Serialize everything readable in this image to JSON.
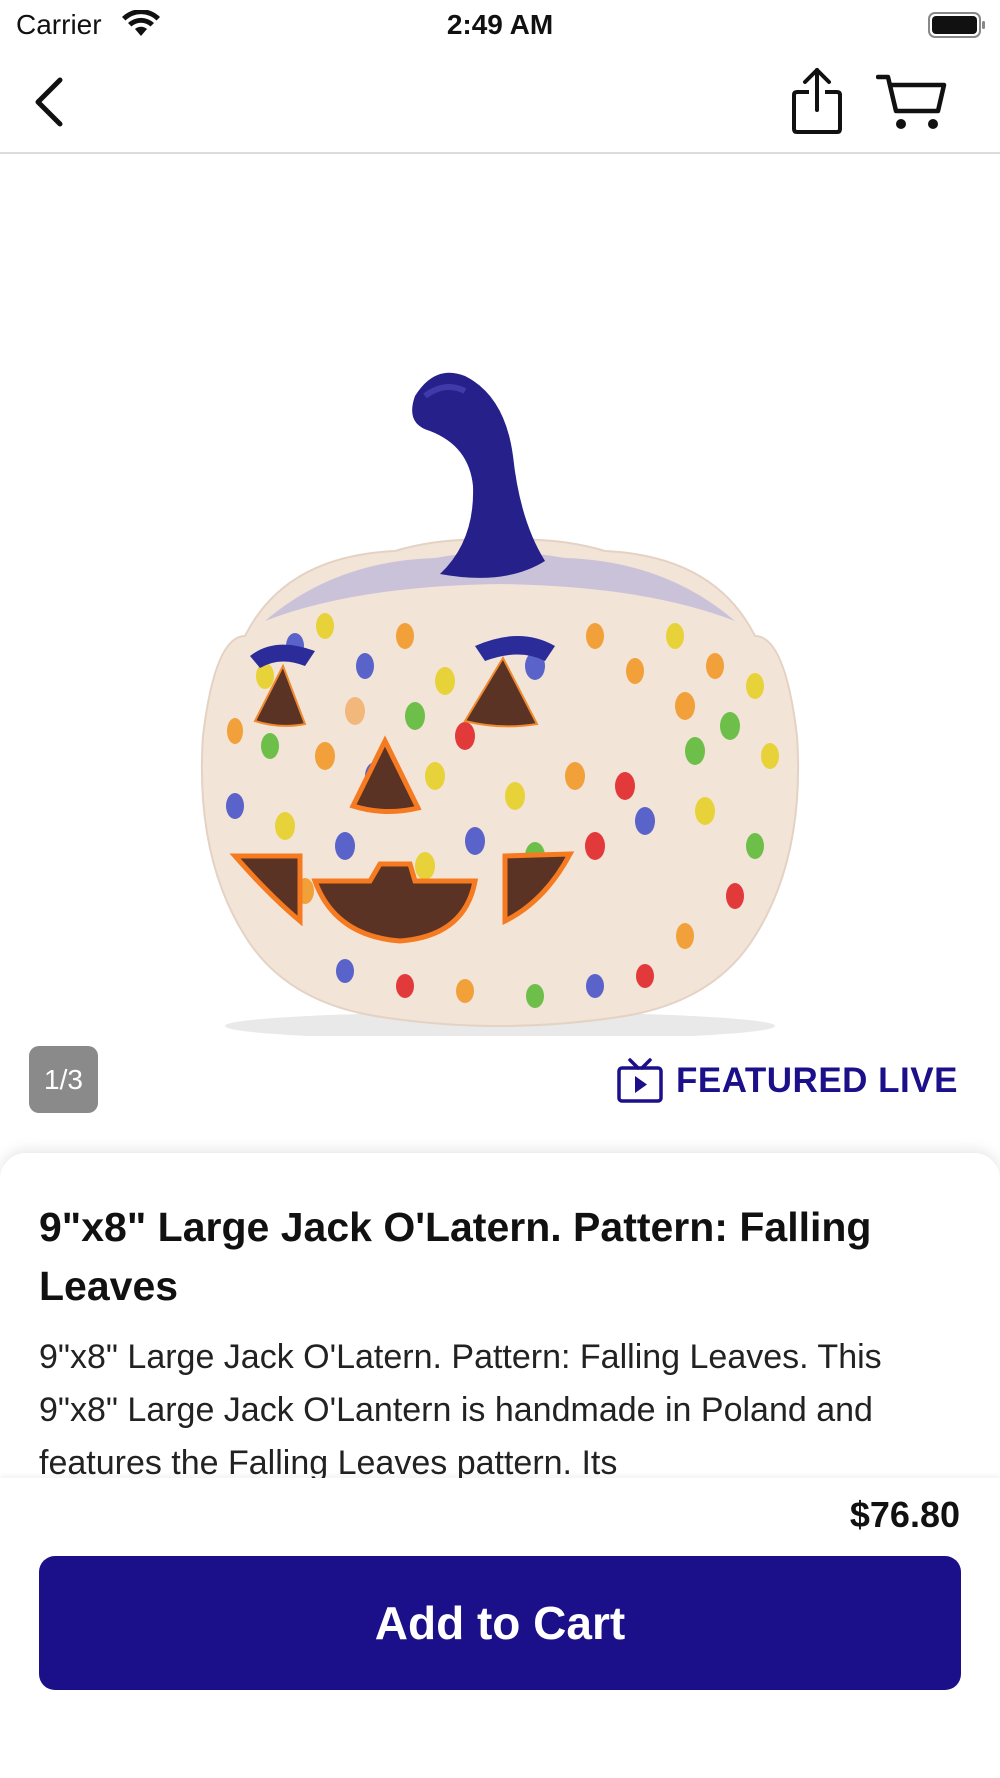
{
  "status_bar": {
    "carrier": "Carrier",
    "time": "2:49 AM"
  },
  "nav": {
    "back_icon": "chevron-left-icon",
    "share_icon": "share-icon",
    "cart_icon": "cart-icon"
  },
  "gallery": {
    "page_indicator": "1/3",
    "featured_label": "FEATURED LIVE",
    "featured_icon": "tv-play-icon"
  },
  "product": {
    "title": "9\"x8\" Large Jack O'Latern. Pattern: Falling Leaves",
    "description": "9\"x8\" Large Jack O'Latern. Pattern: Falling Leaves. This 9\"x8\" Large Jack O'Lantern is handmade in Poland and features the Falling Leaves pattern. Its"
  },
  "purchase": {
    "price": "$76.80",
    "add_to_cart_label": "Add to Cart"
  },
  "colors": {
    "brand": "#1b0f8a",
    "indicator_bg": "#8a8a8a"
  }
}
